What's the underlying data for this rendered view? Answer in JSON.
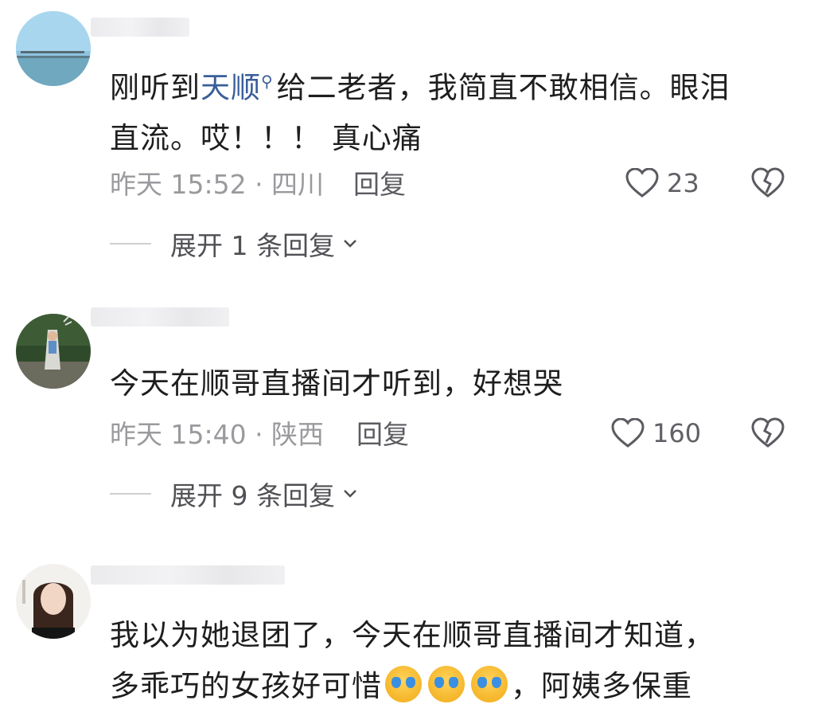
{
  "comments": [
    {
      "text_before": "刚听到",
      "link": "天顺",
      "text_after_line1": "给二老者，我简直不敢相信。眼泪",
      "line2": "直流。哎！！！ 真心痛",
      "meta": "昨天 15:52 · 四川",
      "reply": "回复",
      "likes": "23",
      "expand": "展开 1 条回复"
    },
    {
      "line1": "今天在顺哥直播间才听到，好想哭",
      "meta": "昨天 15:40 · 陕西",
      "reply": "回复",
      "likes": "160",
      "expand": "展开 9 条回复"
    },
    {
      "line1": "我以为她退团了，今天在顺哥直播间才知道，",
      "line2_start": "多乖巧的女孩好可惜",
      "line2_end": "，阿姨多保重"
    }
  ],
  "icons": {
    "search": "search-icon",
    "like": "heart-outline-icon",
    "dislike": "broken-heart-icon",
    "chevron": "chevron-down-icon",
    "emoji": "crying-face-emoji"
  },
  "colors": {
    "link": "#3a5e9a",
    "meta": "#9a9a9e",
    "text": "#1e1e1e"
  }
}
